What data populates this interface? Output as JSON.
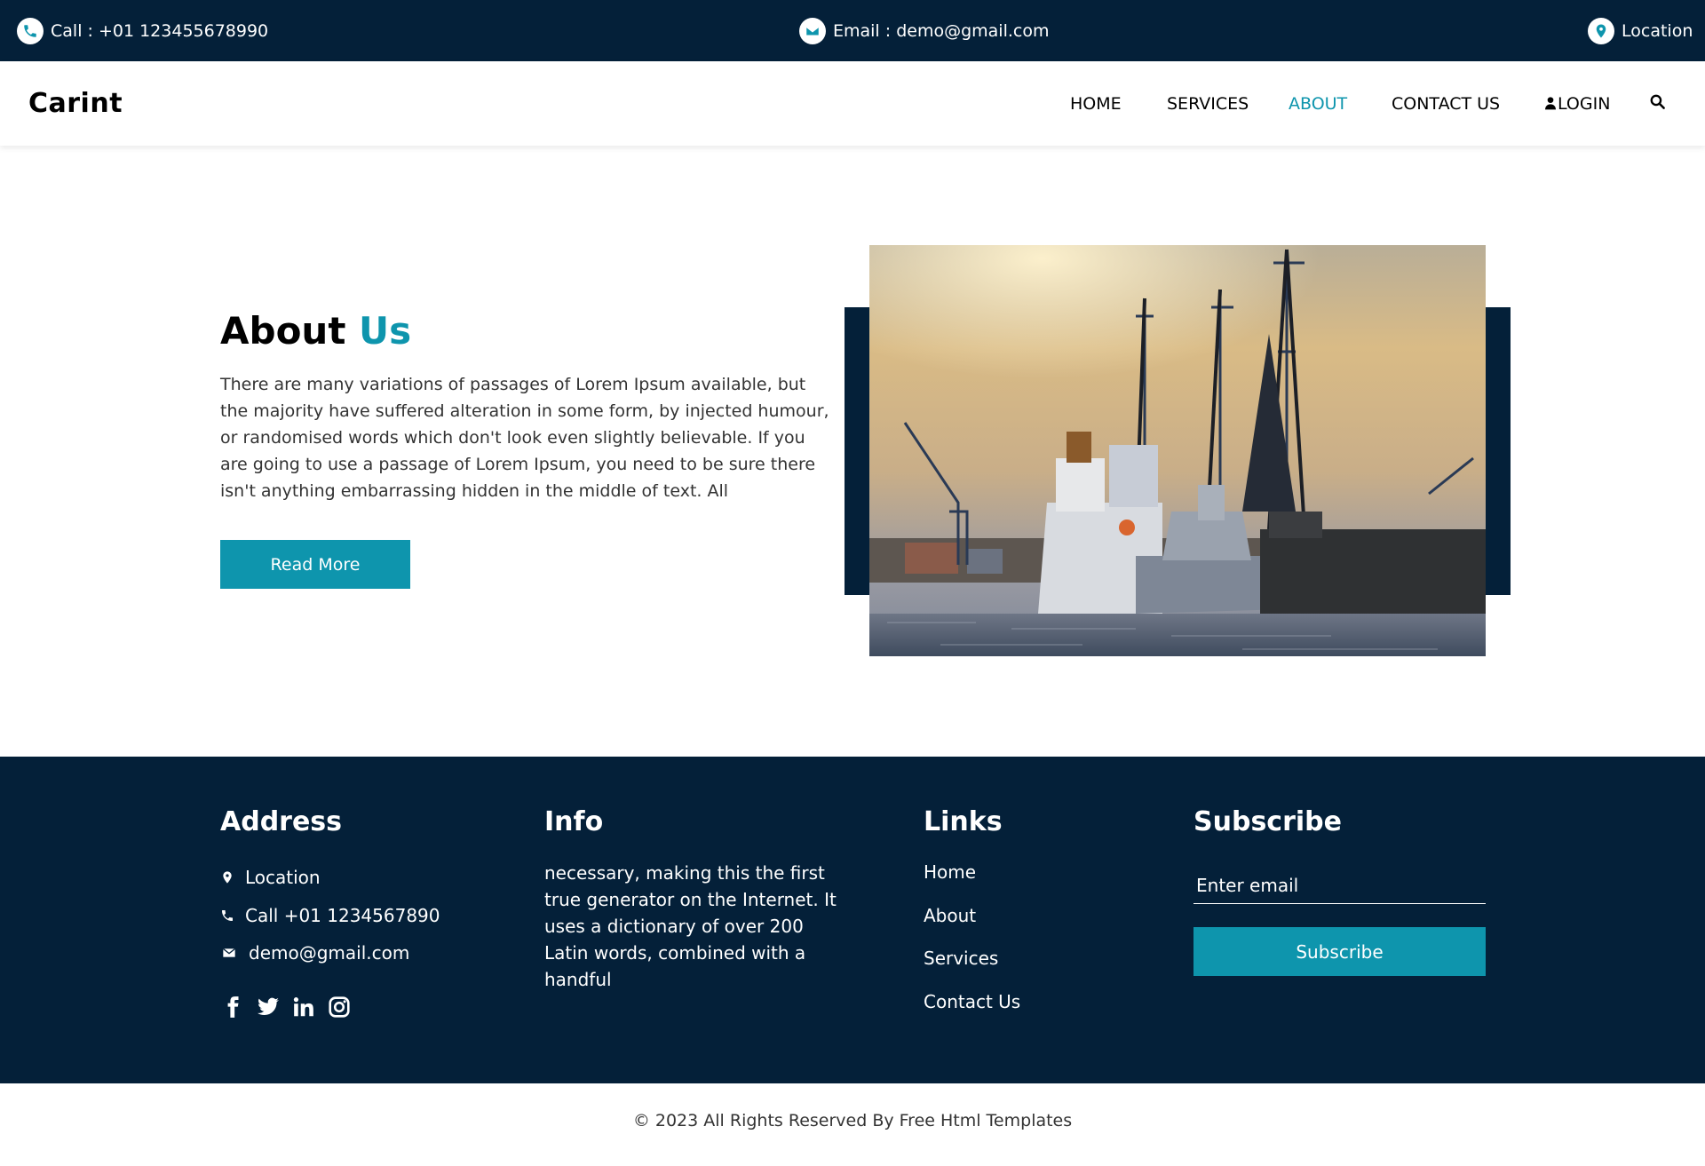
{
  "topbar": {
    "call": "Call : +01 123455678990",
    "email": "Email : demo@gmail.com",
    "location": "Location"
  },
  "header": {
    "brand": "Carint",
    "nav": [
      "HOME",
      "SERVICES",
      "ABOUT",
      "CONTACT US",
      "LOGIN"
    ],
    "active_nav": "ABOUT"
  },
  "about": {
    "title_main": "About",
    "title_accent": "Us",
    "text": "There are many variations of passages of Lorem Ipsum available, but the majority have suffered alteration in some form, by injected humour, or randomised words which don't look even slightly believable. If you are going to use a passage of Lorem Ipsum, you need to be sure there isn't anything embarrassing hidden in the middle of text. All",
    "button": "Read More"
  },
  "footer": {
    "address": {
      "heading": "Address",
      "location": "Location",
      "call": "Call +01 1234567890",
      "email": "demo@gmail.com"
    },
    "info": {
      "heading": "Info",
      "text": "necessary, making this the first true generator on the Internet. It uses a dictionary of over 200 Latin words, combined with a handful"
    },
    "links": {
      "heading": "Links",
      "items": [
        "Home",
        "About",
        "Services",
        "Contact Us"
      ]
    },
    "subscribe": {
      "heading": "Subscribe",
      "placeholder": "Enter email",
      "button": "Subscribe"
    },
    "socials": [
      "facebook-icon",
      "twitter-icon",
      "linkedin-icon",
      "instagram-icon"
    ]
  },
  "copyright": "© 2023 All Rights Reserved By Free Html Templates",
  "colors": {
    "navy": "#042039",
    "accent": "#0e95ad"
  }
}
